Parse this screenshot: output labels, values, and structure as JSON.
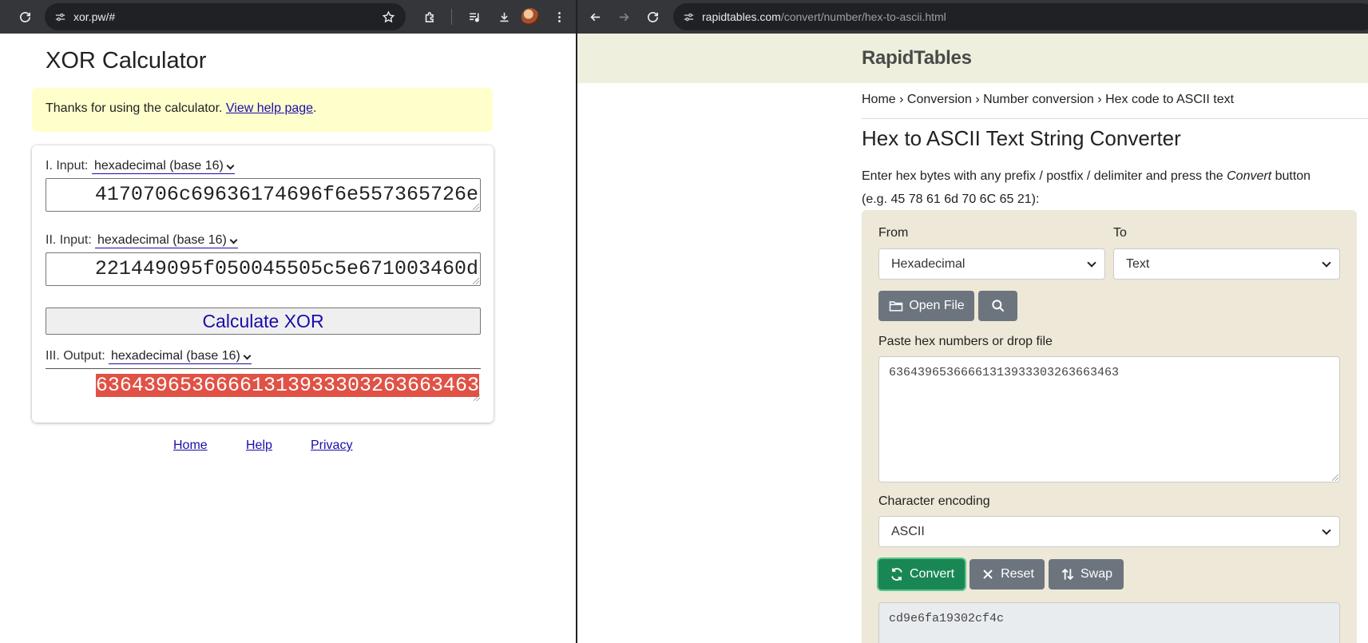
{
  "left_browser": {
    "url": "xor.pw/#"
  },
  "right_browser": {
    "url_host": "rapidtables.com",
    "url_path": "/convert/number/hex-to-ascii.html"
  },
  "xor": {
    "title": "XOR Calculator",
    "notice_text": "Thanks for using the calculator. ",
    "notice_link": "View help page",
    "notice_end": ".",
    "input1_label": "I. Input:",
    "input1_format": "hexadecimal (base 16)",
    "input1_value": "4170706c69636174696f6e557365726e",
    "input2_label": "II. Input:",
    "input2_format": "hexadecimal (base 16)",
    "input2_value": "221449095f050045505c5e671003460d",
    "calculate_label": "Calculate XOR",
    "output_label": "III. Output:",
    "output_format": "hexadecimal (base 16)",
    "output_value": "63643965366661313933303263663463",
    "footer": [
      "Home",
      "Help",
      "Privacy"
    ]
  },
  "rt": {
    "logo": "RapidTables",
    "breadcrumb": [
      "Home",
      "Conversion",
      "Number conversion",
      "Hex code to ASCII text"
    ],
    "heading": "Hex to ASCII Text String Converter",
    "desc_before": "Enter hex bytes with any prefix / postfix / delimiter and press the ",
    "desc_em": "Convert",
    "desc_after": " button",
    "desc_line2": "(e.g. 45 78 61 6d 70 6C 65 21):",
    "from_label": "From",
    "from_value": "Hexadecimal",
    "to_label": "To",
    "to_value": "Text",
    "open_file_label": "Open File",
    "paste_label": "Paste hex numbers or drop file",
    "hex_input": "63643965366661313933303263663463",
    "encoding_label": "Character encoding",
    "encoding_value": "ASCII",
    "convert_label": "Convert",
    "reset_label": "Reset",
    "swap_label": "Swap",
    "output_text": "cd9e6fa19302cf4c"
  }
}
